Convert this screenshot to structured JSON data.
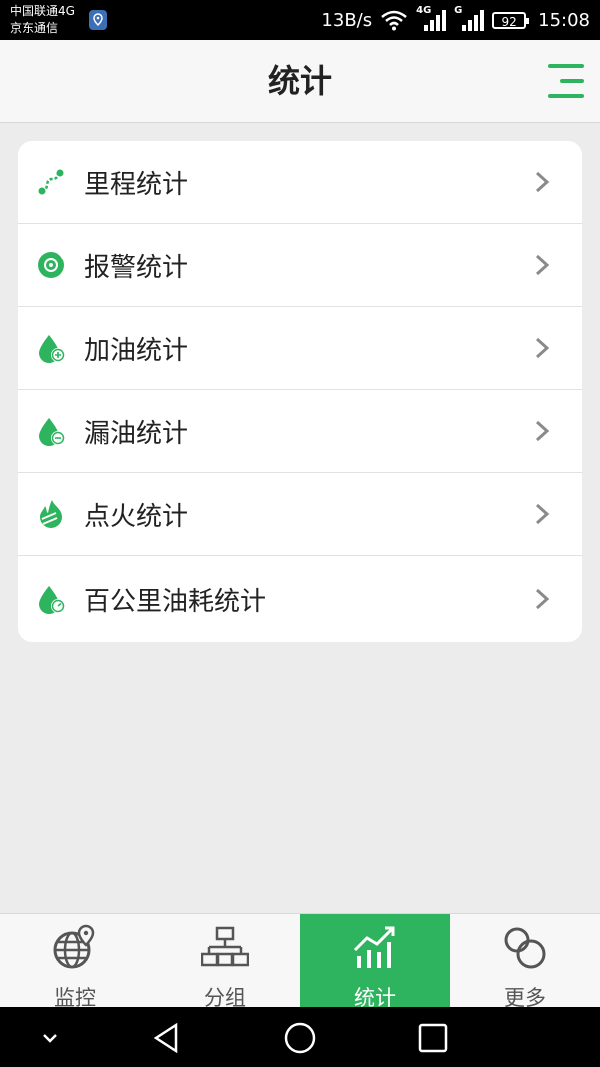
{
  "status_bar": {
    "carrier_line1": "中国联通4G",
    "carrier_line2": "京东通信",
    "network_speed": "13B/s",
    "net_4g": "4G",
    "net_g": "G",
    "battery": "92",
    "time": "15:08"
  },
  "header": {
    "title": "统计"
  },
  "stats_list": [
    {
      "label": "里程统计",
      "icon": "route-icon"
    },
    {
      "label": "报警统计",
      "icon": "alarm-disc-icon"
    },
    {
      "label": "加油统计",
      "icon": "fuel-add-icon"
    },
    {
      "label": "漏油统计",
      "icon": "fuel-leak-icon"
    },
    {
      "label": "点火统计",
      "icon": "ignition-flame-icon"
    },
    {
      "label": "百公里油耗统计",
      "icon": "fuel-consumption-icon"
    }
  ],
  "tabs": [
    {
      "label": "监控",
      "icon": "globe-pin-icon",
      "active": false
    },
    {
      "label": "分组",
      "icon": "org-chart-icon",
      "active": false
    },
    {
      "label": "统计",
      "icon": "chart-trend-icon",
      "active": true
    },
    {
      "label": "更多",
      "icon": "more-circles-icon",
      "active": false
    }
  ],
  "colors": {
    "accent": "#2eb45f",
    "background": "#ececec",
    "header_bg": "#f7f7f7"
  }
}
